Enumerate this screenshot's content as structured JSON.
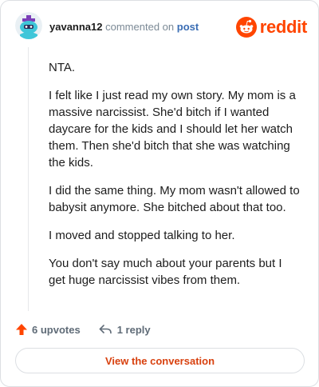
{
  "comment": {
    "username": "yavanna12",
    "action_text": "commented on",
    "post_link": "post",
    "paragraphs": [
      "NTA.",
      "I felt like I just read my own story. My mom is a massive narcissist. She'd bitch if I wanted daycare for the kids and I should let her watch them. Then she'd bitch that she was watching the kids.",
      "I did the same thing. My mom wasn't allowed to babysit anymore. She bitched about that too.",
      "I moved and stopped talking to her.",
      "You don't say much about your parents but I get huge narcissist vibes from them."
    ]
  },
  "brand": {
    "wordmark": "reddit",
    "icon": "reddit-snoo-icon",
    "color": "#ff4500"
  },
  "actions": {
    "upvotes_label": "6 upvotes",
    "upvote_icon": "upvote-arrow-icon",
    "replies_label": "1 reply",
    "reply_icon": "reply-arrow-icon"
  },
  "cta": {
    "label": "View the conversation"
  },
  "colors": {
    "accent": "#ff4500",
    "link": "#3a6db4",
    "cta_text": "#d8410f"
  }
}
